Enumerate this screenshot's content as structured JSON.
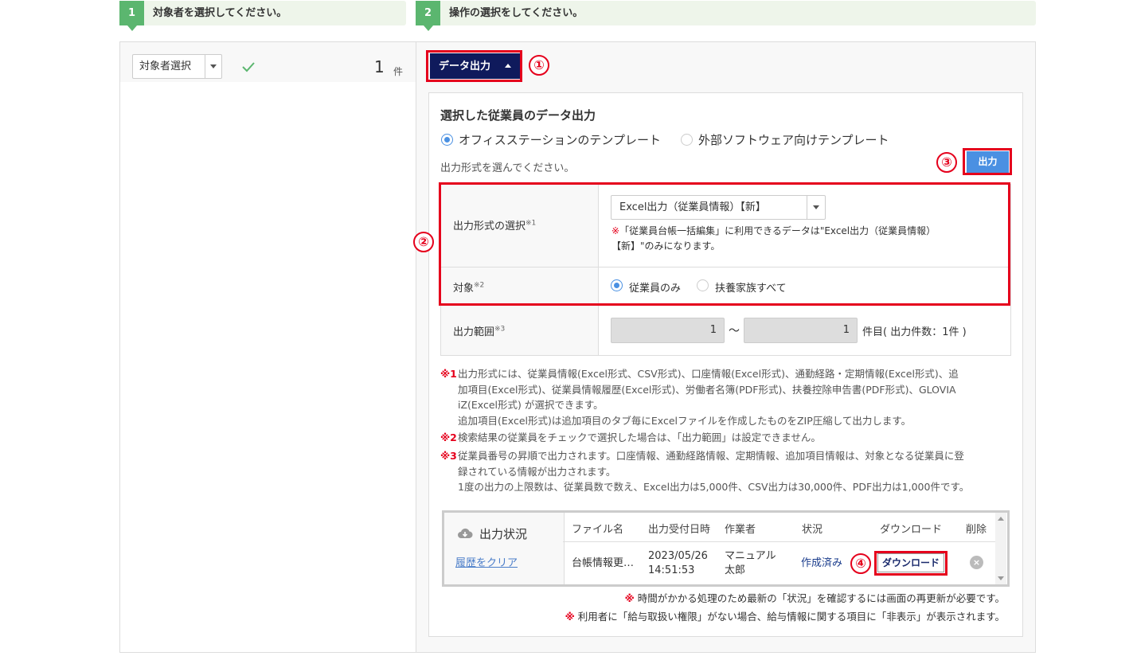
{
  "steps": [
    {
      "num": "1",
      "label": "対象者を選択してください。"
    },
    {
      "num": "2",
      "label": "操作の選択をしてください。"
    }
  ],
  "left": {
    "select_label": "対象者選択",
    "count": "1",
    "count_unit": "件"
  },
  "data_output_button": "データ出力",
  "callouts": [
    "①",
    "②",
    "③",
    "④"
  ],
  "section": {
    "title": "選択した従業員のデータ出力",
    "template_options": [
      "オフィスステーションのテンプレート",
      "外部ソフトウェア向けテンプレート"
    ],
    "template_selected": 0,
    "hint": "出力形式を選んでください。",
    "output_button": "出力"
  },
  "form": {
    "format_label": "出力形式の選択",
    "format_sup": "※1",
    "format_value": "Excel出力（従業員情報）【新】",
    "format_note_mark": "※",
    "format_note_line1": "「従業員台帳一括編集」に利用できるデータは\"Excel出力（従業員情報）",
    "format_note_line2": "【新】\"のみになります。",
    "target_label": "対象",
    "target_sup": "※2",
    "target_options": [
      "従業員のみ",
      "扶養家族すべて"
    ],
    "target_selected": 0,
    "range_label": "出力範囲",
    "range_sup": "※3",
    "range_from": "1",
    "range_sep": "～",
    "range_to": "1",
    "range_note": "件目( 出力件数：1件 )"
  },
  "notes": [
    {
      "mark": "※1",
      "lines": [
        "出力形式には、従業員情報(Excel形式、CSV形式)、口座情報(Excel形式)、通勤経路・定期情報(Excel形式)、追",
        "加項目(Excel形式)、従業員情報履歴(Excel形式)、労働者名簿(PDF形式)、扶養控除申告書(PDF形式)、GLOVIA",
        "iZ(Excel形式) が選択できます。",
        "追加項目(Excel形式)は追加項目のタブ毎にExcelファイルを作成したものをZIP圧縮して出力します。"
      ]
    },
    {
      "mark": "※2",
      "lines": [
        "検索結果の従業員をチェックで選択した場合は、「出力範囲」は設定できません。"
      ]
    },
    {
      "mark": "※3",
      "lines": [
        "従業員番号の昇順で出力されます。口座情報、通勤経路情報、定期情報、追加項目情報は、対象となる従業員に登",
        "録されている情報が出力されます。",
        "1度の出力の上限数は、従業員数で数え、Excel出力は5,000件、CSV出力は30,000件、PDF出力は1,000件です。"
      ]
    }
  ],
  "status": {
    "title": "出力状況",
    "clear_link": "履歴をクリア",
    "headers": [
      "ファイル名",
      "出力受付日時",
      "作業者",
      "状況",
      "ダウンロード",
      "削除"
    ],
    "row": {
      "file": "台帳情報更…",
      "date": "2023/05/26",
      "time": "14:51:53",
      "worker1": "マニュアル",
      "worker2": "太郎",
      "state": "作成済み",
      "download": "ダウンロード",
      "delete": "×"
    }
  },
  "footer": [
    {
      "mark": "※",
      "text": "時間がかかる処理のため最新の「状況」を確認するには画面の再更新が必要です。"
    },
    {
      "mark": "※",
      "text": "利用者に「給与取扱い権限」がない場合、給与情報に関する項目に「非表示」が表示されます。"
    }
  ],
  "colors": {
    "accent_red": "#e5001c",
    "navy": "#0f1a5c",
    "blue": "#4a90e2",
    "green": "#5bb66f"
  }
}
